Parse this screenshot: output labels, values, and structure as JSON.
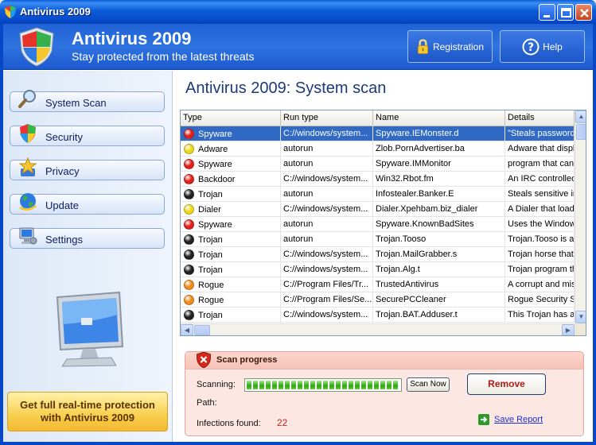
{
  "window": {
    "title": "Antivirus 2009",
    "icon": "shield-icon"
  },
  "header": {
    "title": "Antivirus 2009",
    "subtitle": "Stay protected from the latest threats",
    "registration_label": "Registration",
    "help_label": "Help"
  },
  "sidebar": {
    "items": [
      {
        "label": "System Scan",
        "icon": "magnifier-icon"
      },
      {
        "label": "Security",
        "icon": "shield-icon"
      },
      {
        "label": "Privacy",
        "icon": "star-icon"
      },
      {
        "label": "Update",
        "icon": "globe-icon"
      },
      {
        "label": "Settings",
        "icon": "computer-icon"
      }
    ],
    "promo_line1": "Get full real-time protection",
    "promo_line2": "with Antivirus 2009"
  },
  "main": {
    "title": "Antivirus 2009: System scan",
    "columns": [
      "Type",
      "Run type",
      "Name",
      "Details"
    ],
    "rows": [
      {
        "type": "Spyware",
        "run": "C://windows/system...",
        "name": "Spyware.IEMonster.d",
        "details": "\"Steals passwords",
        "color": "#e0201a"
      },
      {
        "type": "Adware",
        "run": "autorun",
        "name": "Zlob.PornAdvertiser.ba",
        "details": "Adware that displays",
        "color": "#ecd81a"
      },
      {
        "type": "Spyware",
        "run": "autorun",
        "name": "Spyware.IMMonitor",
        "details": "program that can",
        "color": "#e0201a"
      },
      {
        "type": "Backdoor",
        "run": "C://windows/system...",
        "name": "Win32.Rbot.fm",
        "details": "An IRC controlled",
        "color": "#e0201a"
      },
      {
        "type": "Trojan",
        "run": "autorun",
        "name": "Infostealer.Banker.E",
        "details": "Steals sensitive inf",
        "color": "#222222"
      },
      {
        "type": "Dialer",
        "run": "C://windows/system...",
        "name": "Dialer.Xpehbam.biz_dialer",
        "details": "A Dialer that loads",
        "color": "#ecd81a"
      },
      {
        "type": "Spyware",
        "run": "autorun",
        "name": "Spyware.KnownBadSites",
        "details": "Uses the Windows",
        "color": "#e0201a"
      },
      {
        "type": "Trojan",
        "run": "autorun",
        "name": "Trojan.Tooso",
        "details": "Trojan.Tooso is a",
        "color": "#222222"
      },
      {
        "type": "Trojan",
        "run": "C://windows/system...",
        "name": "Trojan.MailGrabber.s",
        "details": "Trojan horse that",
        "color": "#222222"
      },
      {
        "type": "Trojan",
        "run": "C://windows/system...",
        "name": "Trojan.Alg.t",
        "details": "Trojan program th",
        "color": "#222222"
      },
      {
        "type": "Rogue",
        "run": "C://Program Files/Tr...",
        "name": "TrustedAntivirus",
        "details": "A corrupt and mis",
        "color": "#f08a1a"
      },
      {
        "type": "Rogue",
        "run": "C://Program Files/Se...",
        "name": "SecurePCCleaner",
        "details": "Rogue Security So",
        "color": "#f08a1a"
      },
      {
        "type": "Trojan",
        "run": "C://windows/system...",
        "name": "Trojan.BAT.Adduser.t",
        "details": "This Trojan has a",
        "color": "#222222"
      }
    ]
  },
  "scan": {
    "title": "Scan progress",
    "scanning_label": "Scanning:",
    "path_label": "Path:",
    "infections_label": "Infections found:",
    "infections_count": "22",
    "scan_now_label": "Scan Now",
    "remove_label": "Remove",
    "save_report_label": "Save Report",
    "progress_fraction": 1.0
  }
}
